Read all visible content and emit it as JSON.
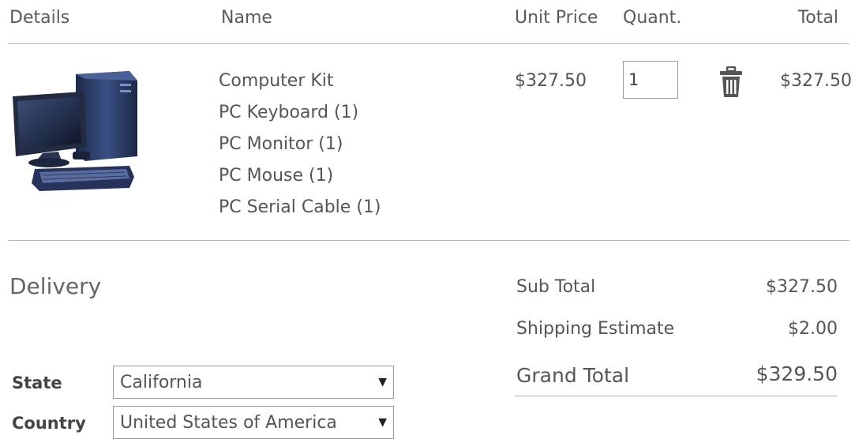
{
  "table": {
    "headers": {
      "details": "Details",
      "name": "Name",
      "unit_price": "Unit Price",
      "quantity": "Quant.",
      "total": "Total"
    },
    "item": {
      "image_icon": "desktop-computer-icon",
      "name_lines": [
        "Computer Kit",
        "PC Keyboard (1)",
        "PC Monitor (1)",
        "PC Mouse (1)",
        "PC Serial Cable (1)"
      ],
      "unit_price": "$327.50",
      "quantity": "1",
      "delete_icon": "trash-icon",
      "total": "$327.50"
    }
  },
  "delivery": {
    "title": "Delivery",
    "state_label": "State",
    "state_value": "California",
    "country_label": "Country",
    "country_value": "United States of America"
  },
  "summary": {
    "subtotal_label": "Sub Total",
    "subtotal_value": "$327.50",
    "shipping_label": "Shipping Estimate",
    "shipping_value": "$2.00",
    "grand_total_label": "Grand Total",
    "grand_total_value": "$329.50"
  },
  "colors": {
    "text": "#555555",
    "divider": "#b5b5b5",
    "computer_body": "#2e3f66"
  }
}
